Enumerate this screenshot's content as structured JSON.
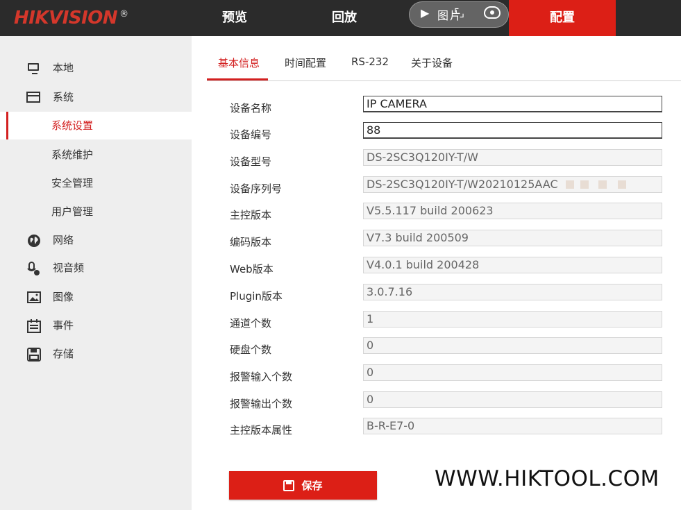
{
  "header": {
    "logo": "HIKVISION",
    "logo_mark": "®",
    "nav": {
      "preview": "预览",
      "playback": "回放",
      "picture": "图片",
      "config": "配置"
    }
  },
  "sidebar": {
    "items": [
      {
        "label": "本地",
        "icon": "monitor-icon"
      },
      {
        "label": "系统",
        "icon": "system-icon"
      },
      {
        "label": "系统设置",
        "active": true
      },
      {
        "label": "系统维护"
      },
      {
        "label": "安全管理"
      },
      {
        "label": "用户管理"
      },
      {
        "label": "网络",
        "icon": "globe-icon"
      },
      {
        "label": "视音频",
        "icon": "microphone-icon"
      },
      {
        "label": "图像",
        "icon": "image-icon"
      },
      {
        "label": "事件",
        "icon": "calendar-icon"
      },
      {
        "label": "存储",
        "icon": "floppy-icon"
      }
    ]
  },
  "tabs": {
    "basic": "基本信息",
    "time": "时间配置",
    "rs232": "RS-232",
    "about": "关于设备"
  },
  "form": {
    "rows": [
      {
        "label": "设备名称",
        "value": "IP CAMERA",
        "editable": true
      },
      {
        "label": "设备编号",
        "value": "88",
        "editable": true
      },
      {
        "label": "设备型号",
        "value": "DS-2SC3Q120IY-T/W",
        "editable": false
      },
      {
        "label": "设备序列号",
        "value": "DS-2SC3Q120IY-T/W20210125AAC",
        "editable": false
      },
      {
        "label": "主控版本",
        "value": "V5.5.117 build 200623",
        "editable": false
      },
      {
        "label": "编码版本",
        "value": "V7.3 build 200509",
        "editable": false
      },
      {
        "label": "Web版本",
        "value": "V4.0.1 build 200428",
        "editable": false
      },
      {
        "label": "Plugin版本",
        "value": "3.0.7.16",
        "editable": false
      },
      {
        "label": "通道个数",
        "value": "1",
        "editable": false
      },
      {
        "label": "硬盘个数",
        "value": "0",
        "editable": false
      },
      {
        "label": "报警输入个数",
        "value": "0",
        "editable": false
      },
      {
        "label": "报警输出个数",
        "value": "0",
        "editable": false
      },
      {
        "label": "主控版本属性",
        "value": "B-R-E7-0",
        "editable": false
      }
    ]
  },
  "save_label": "保存",
  "watermark": "WWW.HIKTOOL.COM",
  "colors": {
    "accent": "#dc1f16",
    "topbar": "#2b2b2b",
    "sidebar_bg": "#eeeeee"
  }
}
